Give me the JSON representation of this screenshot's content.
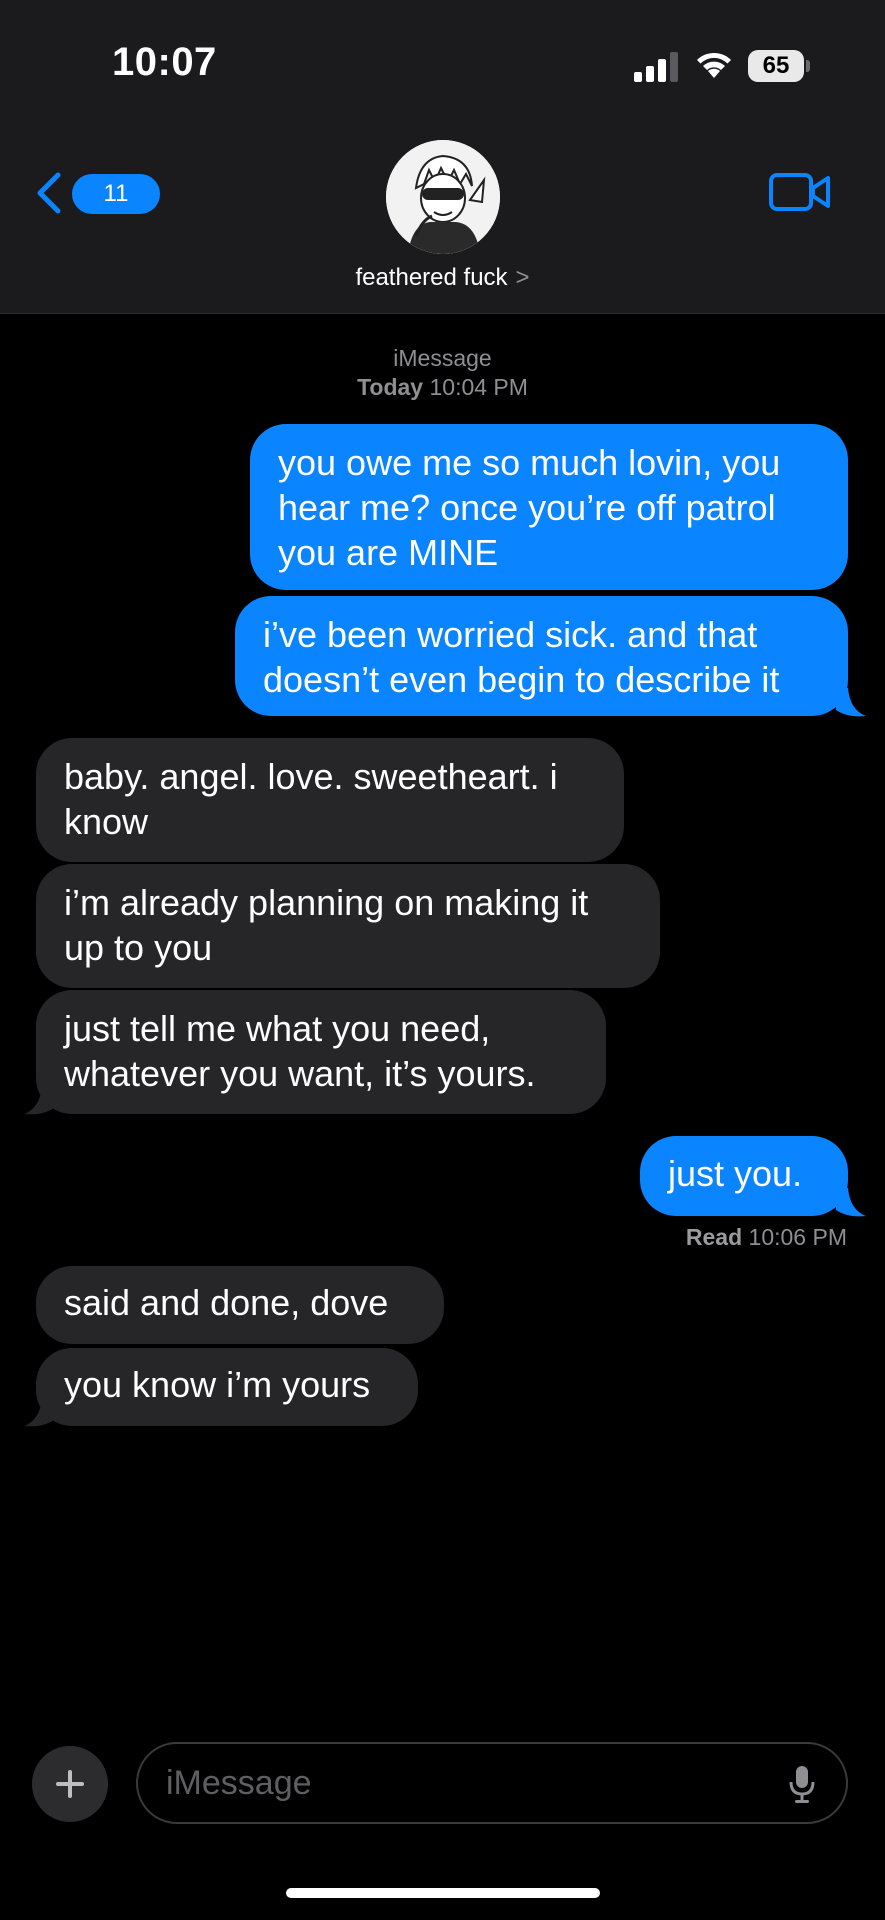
{
  "status_bar": {
    "time": "10:07",
    "battery": "65"
  },
  "nav": {
    "back_count": "11",
    "contact_name": "feathered fuck",
    "chevron": ">"
  },
  "conversation": {
    "service": "iMessage",
    "timestamp_day": "Today",
    "timestamp_time": "10:04 PM",
    "messages": [
      {
        "from": "me",
        "text_lines": [
          "you owe me so much lovin, you",
          "hear me? once you’re off patrol",
          "you are MINE"
        ]
      },
      {
        "from": "me",
        "text_lines": [
          "i’ve been worried sick. and that",
          "doesn’t even begin to describe it"
        ]
      },
      {
        "from": "them",
        "text_lines": [
          "baby. angel. love. sweetheart. i",
          "know"
        ]
      },
      {
        "from": "them",
        "text_lines": [
          "i’m already planning on making it",
          "up to you"
        ]
      },
      {
        "from": "them",
        "text_lines": [
          "just tell me what you need,",
          "whatever you want, it’s yours."
        ]
      },
      {
        "from": "me",
        "text_lines": [
          "just you."
        ]
      },
      {
        "from": "them",
        "text_lines": [
          "said and done, dove"
        ]
      },
      {
        "from": "them",
        "text_lines": [
          "you know i’m yours"
        ]
      }
    ],
    "read_label": "Read",
    "read_time": "10:06 PM"
  },
  "composer": {
    "placeholder": "iMessage"
  },
  "colors": {
    "sent_bubble": "#0a84ff",
    "received_bubble": "#262629",
    "header_bg": "#1b1b1d",
    "background": "#000000"
  }
}
